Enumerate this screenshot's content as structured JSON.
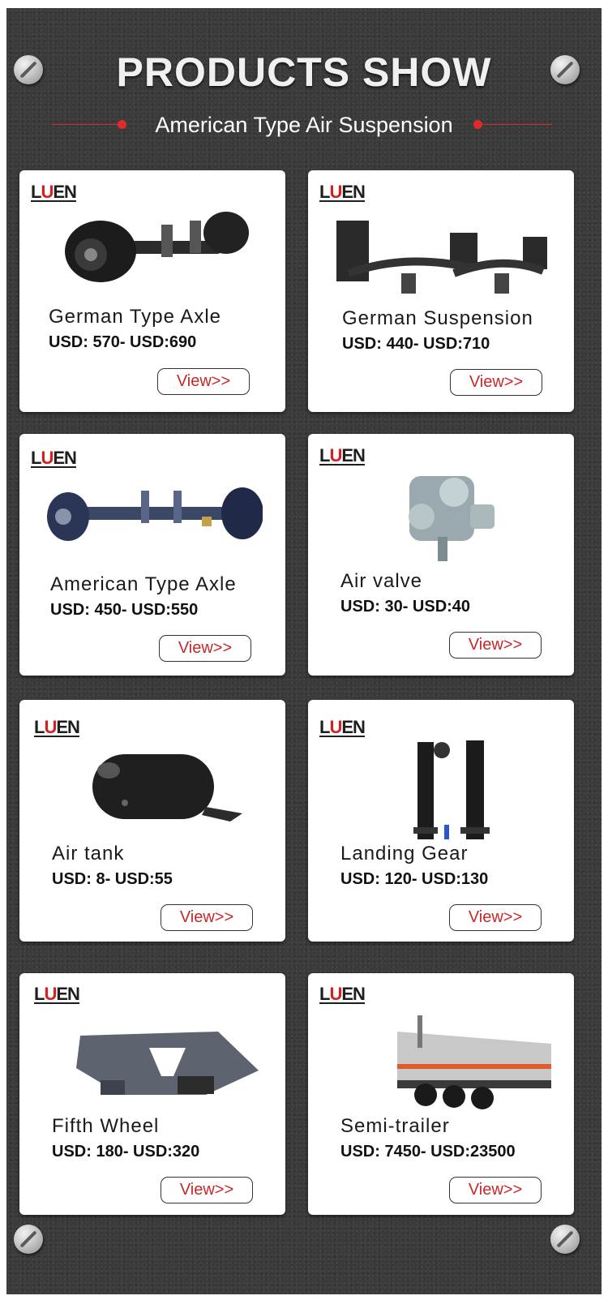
{
  "header": {
    "title": "PRODUCTS SHOW",
    "subtitle": "American Type Air Suspension"
  },
  "brand": {
    "logo": "LUEN"
  },
  "products": [
    {
      "name": "German Type Axle",
      "price": "USD: 570- USD:690",
      "button": "View>>",
      "icon": "axle"
    },
    {
      "name": "German  Suspension",
      "price": "USD: 440- USD:710",
      "button": "View>>",
      "icon": "suspension"
    },
    {
      "name": "American Type Axle",
      "price": "USD: 450- USD:550",
      "button": "View>>",
      "icon": "axle-american"
    },
    {
      "name": "Air valve",
      "price": "USD: 30- USD:40",
      "button": "View>>",
      "icon": "air-valve"
    },
    {
      "name": "Air tank",
      "price": "USD: 8- USD:55",
      "button": "View>>",
      "icon": "air-tank"
    },
    {
      "name": "Landing Gear",
      "price": "USD: 120- USD:130",
      "button": "View>>",
      "icon": "landing-gear"
    },
    {
      "name": "Fifth Wheel",
      "price": "USD: 180- USD:320",
      "button": "View>>",
      "icon": "fifth-wheel"
    },
    {
      "name": "Semi-trailer",
      "price": "USD: 7450- USD:23500",
      "button": "View>>",
      "icon": "semi-trailer"
    }
  ],
  "colors": {
    "accent": "#d42020",
    "board": "#3b3b3b",
    "card": "#ffffff"
  }
}
